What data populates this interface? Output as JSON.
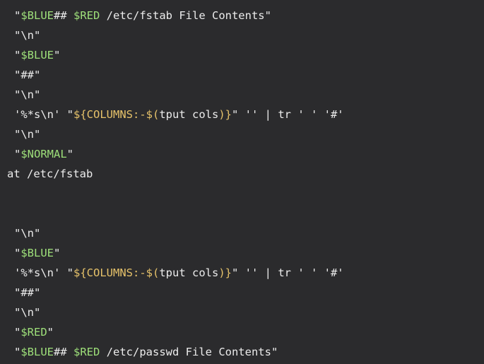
{
  "colors": {
    "background": "#2b2b2d",
    "text": "#ececec",
    "variable": "#9ee07a",
    "substitution": "#e6c26a"
  },
  "gutter_mark": "·",
  "lines": [
    {
      "tokens": [
        {
          "text": "\"",
          "type": "str"
        },
        {
          "text": "$BLUE",
          "type": "var"
        },
        {
          "text": "## ",
          "type": "str"
        },
        {
          "text": "$RED",
          "type": "var"
        },
        {
          "text": " /etc/fstab File Contents\"",
          "type": "str"
        }
      ]
    },
    {
      "tokens": [
        {
          "text": "\"\\n\"",
          "type": "str"
        }
      ]
    },
    {
      "tokens": [
        {
          "text": "\"",
          "type": "str"
        },
        {
          "text": "$BLUE",
          "type": "var"
        },
        {
          "text": "\"",
          "type": "str"
        }
      ]
    },
    {
      "tokens": [
        {
          "text": "\"##\"",
          "type": "str"
        }
      ]
    },
    {
      "tokens": [
        {
          "text": "\"\\n\"",
          "type": "str"
        }
      ]
    },
    {
      "tokens": [
        {
          "text": "'%*s\\n' \"",
          "type": "str"
        },
        {
          "text": "${COLUMNS:-$(",
          "type": "sub"
        },
        {
          "text": "tput cols",
          "type": "str"
        },
        {
          "text": ")}",
          "type": "sub"
        },
        {
          "text": "\" '' | tr ' ' '#'",
          "type": "str"
        }
      ]
    },
    {
      "tokens": [
        {
          "text": "\"\\n\"",
          "type": "str"
        }
      ]
    },
    {
      "tokens": [
        {
          "text": "\"",
          "type": "str"
        },
        {
          "text": "$NORMAL",
          "type": "var"
        },
        {
          "text": "\"",
          "type": "str"
        }
      ]
    },
    {
      "tokens": [
        {
          "text": "at /etc/fstab",
          "type": "plain"
        }
      ]
    },
    {
      "tokens": []
    },
    {
      "tokens": []
    },
    {
      "tokens": [
        {
          "text": "\"\\n\"",
          "type": "str"
        }
      ]
    },
    {
      "tokens": [
        {
          "text": "\"",
          "type": "str"
        },
        {
          "text": "$BLUE",
          "type": "var"
        },
        {
          "text": "\"",
          "type": "str"
        }
      ]
    },
    {
      "tokens": [
        {
          "text": "'%*s\\n' \"",
          "type": "str"
        },
        {
          "text": "${COLUMNS:-$(",
          "type": "sub"
        },
        {
          "text": "tput cols",
          "type": "str"
        },
        {
          "text": ")}",
          "type": "sub"
        },
        {
          "text": "\" '' | tr ' ' '#'",
          "type": "str"
        }
      ]
    },
    {
      "tokens": [
        {
          "text": "\"##\"",
          "type": "str"
        }
      ]
    },
    {
      "tokens": [
        {
          "text": "\"\\n\"",
          "type": "str"
        }
      ]
    },
    {
      "tokens": [
        {
          "text": "\"",
          "type": "str"
        },
        {
          "text": "$RED",
          "type": "var"
        },
        {
          "text": "\"",
          "type": "str"
        }
      ]
    },
    {
      "tokens": [
        {
          "text": "\"",
          "type": "str"
        },
        {
          "text": "$BLUE",
          "type": "var"
        },
        {
          "text": "## ",
          "type": "str"
        },
        {
          "text": "$RED",
          "type": "var"
        },
        {
          "text": " /etc/passwd File Contents\"",
          "type": "str"
        }
      ]
    }
  ]
}
